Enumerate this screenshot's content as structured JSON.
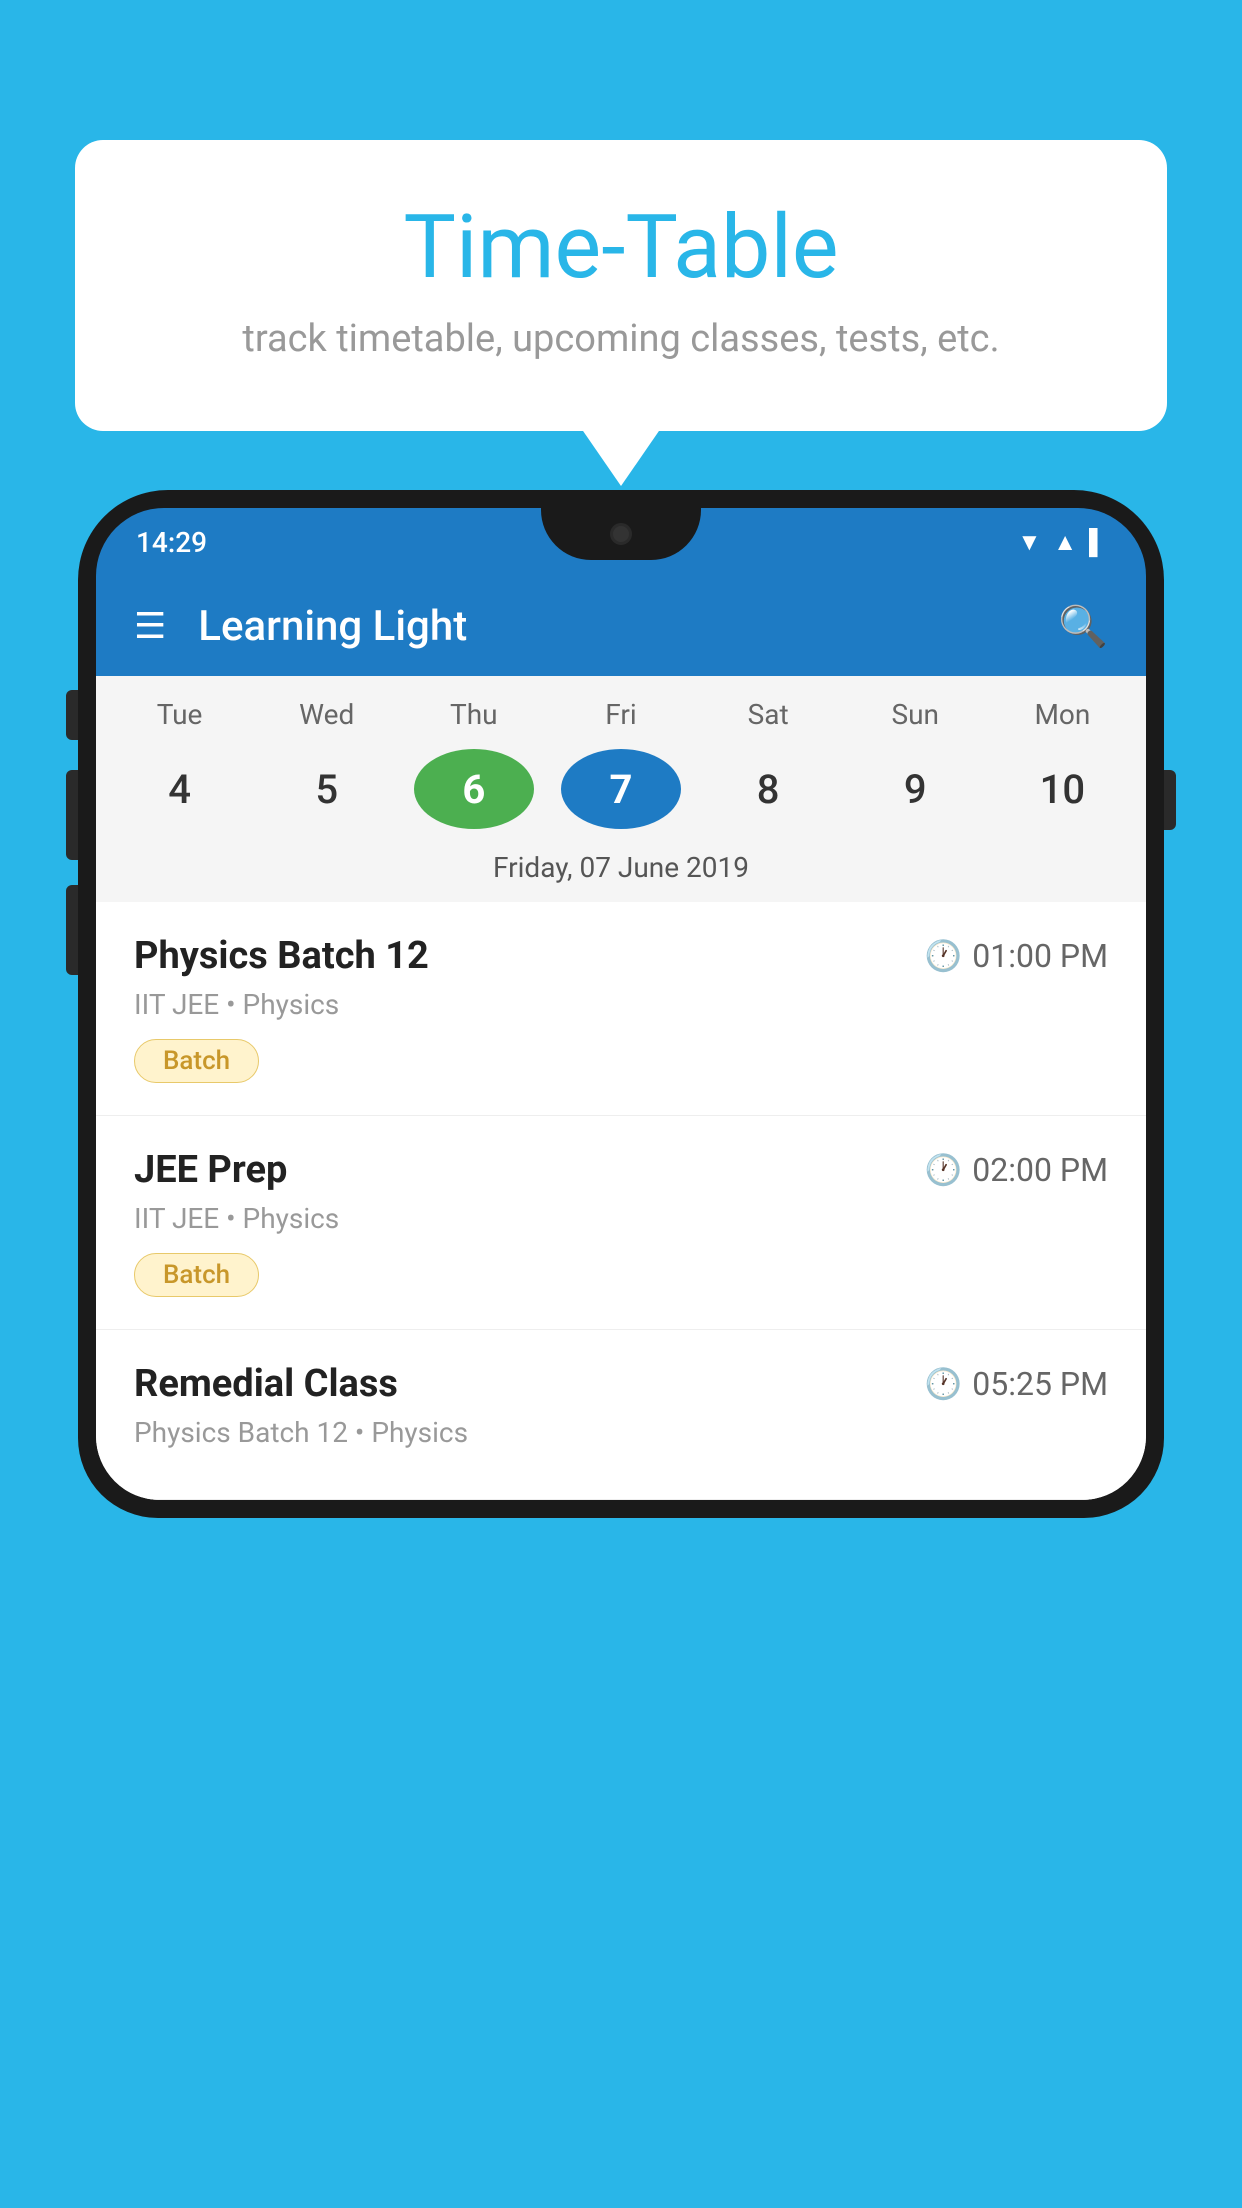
{
  "background_color": "#29B6E8",
  "speech_bubble": {
    "title": "Time-Table",
    "subtitle": "track timetable, upcoming classes, tests, etc."
  },
  "app": {
    "name": "Learning Light",
    "status_time": "14:29"
  },
  "calendar": {
    "selected_date_label": "Friday, 07 June 2019",
    "days": [
      {
        "name": "Tue",
        "number": "4",
        "state": "normal"
      },
      {
        "name": "Wed",
        "number": "5",
        "state": "normal"
      },
      {
        "name": "Thu",
        "number": "6",
        "state": "today"
      },
      {
        "name": "Fri",
        "number": "7",
        "state": "selected"
      },
      {
        "name": "Sat",
        "number": "8",
        "state": "normal"
      },
      {
        "name": "Sun",
        "number": "9",
        "state": "normal"
      },
      {
        "name": "Mon",
        "number": "10",
        "state": "normal"
      }
    ]
  },
  "schedule": [
    {
      "title": "Physics Batch 12",
      "time": "01:00 PM",
      "subtitle": "IIT JEE • Physics",
      "badge": "Batch"
    },
    {
      "title": "JEE Prep",
      "time": "02:00 PM",
      "subtitle": "IIT JEE • Physics",
      "badge": "Batch"
    },
    {
      "title": "Remedial Class",
      "time": "05:25 PM",
      "subtitle": "Physics Batch 12 • Physics",
      "badge": null
    }
  ],
  "labels": {
    "hamburger": "☰",
    "search": "🔍",
    "clock": "🕐"
  }
}
